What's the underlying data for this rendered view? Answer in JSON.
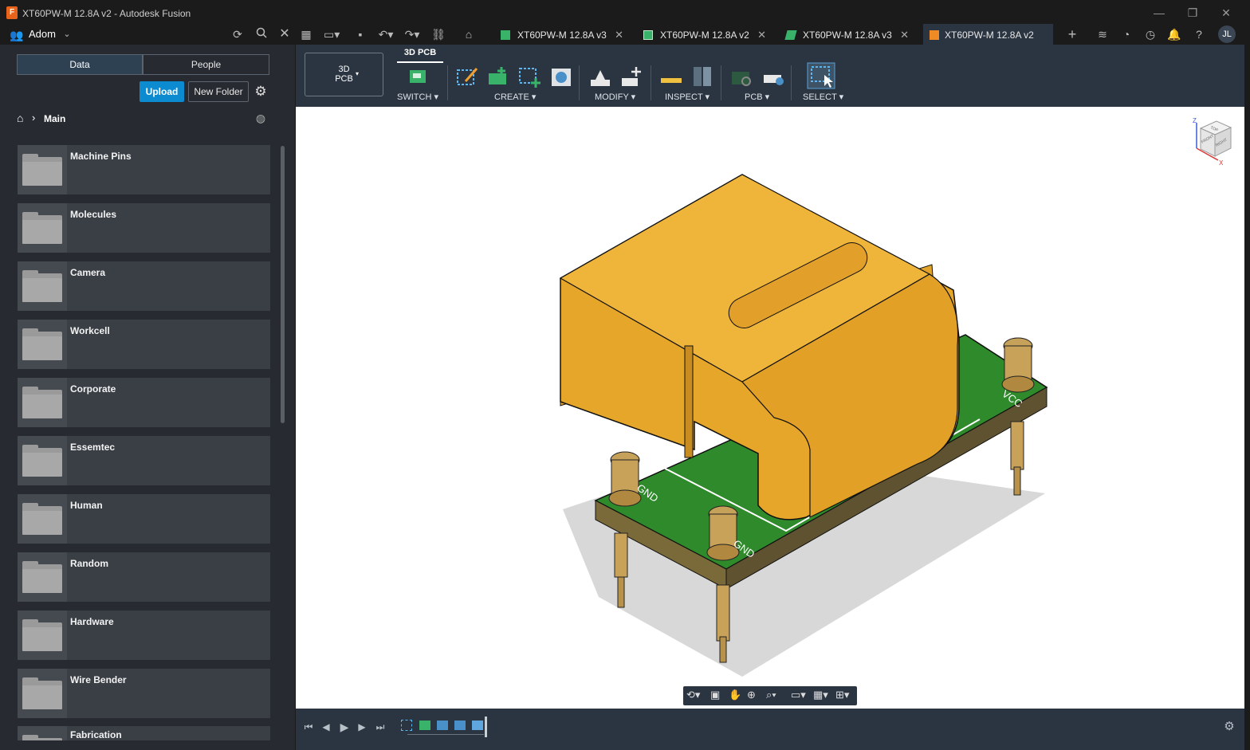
{
  "window": {
    "title": "XT60PW-M 12.8A v2 - Autodesk Fusion",
    "app_badge": "F"
  },
  "appbar": {
    "team_name": "Adom",
    "user_initials": "JL"
  },
  "tabs": [
    {
      "label": "XT60PW-M 12.8A v3",
      "icon": "pcb-3d-icon",
      "color": "#39b36a"
    },
    {
      "label": "XT60PW-M 12.8A v2",
      "icon": "schematic-icon",
      "color": "#39b36a"
    },
    {
      "label": "XT60PW-M 12.8A v3",
      "icon": "pcb-board-icon",
      "color": "#39b36a"
    },
    {
      "label": "XT60PW-M 12.8A v2",
      "icon": "component-box-icon",
      "color": "#f08a24",
      "active": true
    }
  ],
  "sidebar": {
    "segments": [
      "Data",
      "People"
    ],
    "active_segment": "Data",
    "upload_label": "Upload",
    "new_folder_label": "New Folder",
    "breadcrumb": "Main",
    "folders": [
      "Machine Pins",
      "Molecules",
      "Camera",
      "Workcell",
      "Corporate",
      "Essemtec",
      "Human",
      "Random",
      "Hardware",
      "Wire Bender",
      "Fabrication"
    ]
  },
  "ribbon": {
    "workspace_line1": "3D",
    "workspace_line2": "PCB",
    "active_tab": "3D PCB",
    "groups": [
      "SWITCH",
      "CREATE",
      "MODIFY",
      "INSPECT",
      "PCB",
      "SELECT"
    ]
  },
  "viewcube": {
    "axes": [
      "Z",
      "X"
    ],
    "faces": [
      "TOP",
      "FRONT",
      "RIGHT"
    ]
  },
  "model": {
    "pad_labels": [
      "VCC",
      "GND",
      "GND"
    ],
    "body_color": "#e6a629",
    "board_color": "#2e8a2a"
  },
  "colors": {
    "accent": "#0d8bd1",
    "ribbon_bg": "#2b3542",
    "sidebar_bg": "#272b31"
  }
}
